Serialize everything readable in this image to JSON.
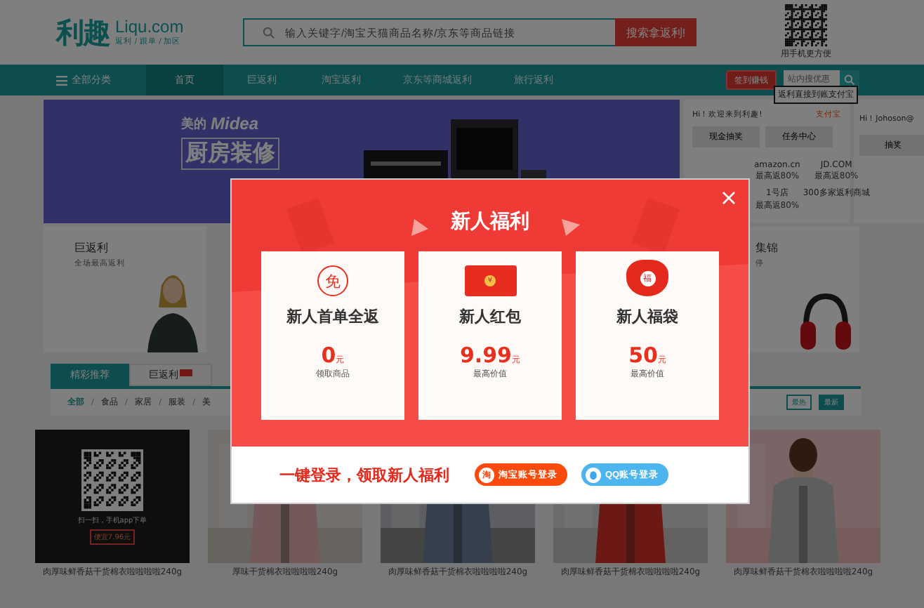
{
  "header": {
    "logo": "利趣",
    "domain": "Liqu.com",
    "slogan": "返利 / 跟单 / 加区",
    "search": {
      "placeholder": "输入关键字/淘宝天猫商品名称/京东等商品链接",
      "button": "搜索拿返利!"
    },
    "qr_caption": "用手机更方便"
  },
  "nav": {
    "menu": "全部分类",
    "items": [
      {
        "label": "首页",
        "selected": true
      },
      {
        "label": "巨返利",
        "selected": false
      },
      {
        "label": "淘宝返利",
        "selected": false
      },
      {
        "label": "京东等商城返利",
        "selected": false
      },
      {
        "label": "旅行返利",
        "selected": false
      }
    ],
    "signin": "签到赚钱",
    "search_placeholder": "站内搜优惠"
  },
  "banner": {
    "brand": "美的",
    "logo": "Midea",
    "headline": "厨房装修"
  },
  "user_panel": {
    "greeting": "Hi！欢迎来到利趣!",
    "link": "支付宝",
    "tooltip": "返利直接到账支付宝",
    "buttons": [
      "现金抽奖",
      "任务中心"
    ],
    "stores": [
      {
        "name": "amazon.cn",
        "note": "最高返80%"
      },
      {
        "name": "JD.COM",
        "note": "最高返80%"
      },
      {
        "name": "1号店",
        "note": "最高返80%"
      },
      {
        "name": "300多家返利商城"
      }
    ]
  },
  "second_panel": {
    "greeting": "Hi！Johoson@",
    "button": "抽奖"
  },
  "promos": [
    {
      "title": "巨返利",
      "subtitle": "全场最高返利",
      "kind": "person"
    },
    {
      "title": "集锦",
      "subtitle": "停",
      "kind": "headphones"
    }
  ],
  "tabs": [
    {
      "label": "精彩推荐",
      "selected": true,
      "hot": false
    },
    {
      "label": "巨返利",
      "selected": false,
      "hot": true
    }
  ],
  "filter_separator": "/",
  "filters": [
    {
      "label": "全部",
      "selected": true
    },
    {
      "label": "食品",
      "selected": false
    },
    {
      "label": "家居",
      "selected": false
    },
    {
      "label": "服装",
      "selected": false
    },
    {
      "label": "美",
      "selected": false
    }
  ],
  "sort": [
    {
      "label": "最热",
      "selected": false
    },
    {
      "label": "最新",
      "selected": true
    }
  ],
  "products": [
    {
      "kind": "qr",
      "caption": "扫一扫，手机app下单",
      "price": "便宜7.96元",
      "title": "肉厚味鲜香菇干货棉衣啦啦啦啦240g"
    },
    {
      "kind": "picture",
      "title": "厚味干货棉衣啦啦啦啦240g"
    },
    {
      "kind": "picture",
      "title": "肉厚味鲜香菇干货棉衣啦啦啦啦240g"
    },
    {
      "kind": "picture",
      "title": "肉厚味鲜香菇干货棉衣啦啦啦啦240g"
    },
    {
      "kind": "picture",
      "title": "肉厚味鲜香菇干货棉衣啦啦啦啦240g"
    }
  ],
  "modal": {
    "title": "新人福利",
    "cards": [
      {
        "kind": "free",
        "icon_text": "免",
        "title": "新人首单全返",
        "amount": "0",
        "unit": "元",
        "note": "领取商品"
      },
      {
        "kind": "envelope",
        "icon_text": "¥",
        "title": "新人红包",
        "amount": "9.99",
        "unit": "元",
        "note": "最高价值"
      },
      {
        "kind": "bag",
        "icon_text": "福",
        "title": "新人福袋",
        "amount": "50",
        "unit": "元",
        "note": "最高价值"
      }
    ],
    "cta": "一键登录，领取新人福利",
    "logins": [
      {
        "kind": "taobao",
        "icon_text": "淘",
        "label": "淘宝账号登录"
      },
      {
        "kind": "qq",
        "label": "QQ账号登录"
      }
    ]
  }
}
